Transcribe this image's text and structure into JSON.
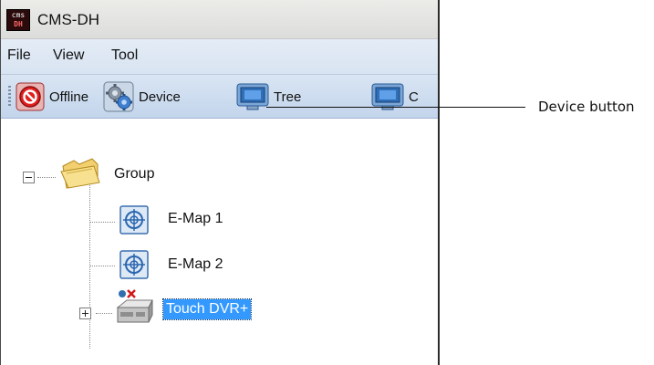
{
  "window": {
    "title": "CMS-DH",
    "app_icon": {
      "name": "cms-dh-app-icon",
      "top_text": "cms",
      "bottom_text": "DH"
    }
  },
  "menu": {
    "items": [
      "File",
      "View",
      "Tool"
    ]
  },
  "toolbar": {
    "buttons": [
      {
        "label": "Offline",
        "icon": "offline-icon"
      },
      {
        "label": "Device",
        "icon": "gear-icon"
      },
      {
        "label": "Tree",
        "icon": "monitor-icon"
      },
      {
        "label": "C",
        "icon": "monitor-icon"
      }
    ]
  },
  "tree": {
    "root": {
      "label": "Group",
      "expanded": true,
      "icon": "folder-icon"
    },
    "children": [
      {
        "label": "E-Map 1",
        "icon": "emap-icon"
      },
      {
        "label": "E-Map 2",
        "icon": "emap-icon"
      },
      {
        "label": "Touch DVR+",
        "icon": "dvr-icon",
        "expanded": false,
        "selected": true
      }
    ]
  },
  "callout": {
    "label": "Device button"
  },
  "colors": {
    "selection": "#3399ff",
    "menubar": "#dde7f3",
    "toolbar": "#c3d5ec"
  }
}
